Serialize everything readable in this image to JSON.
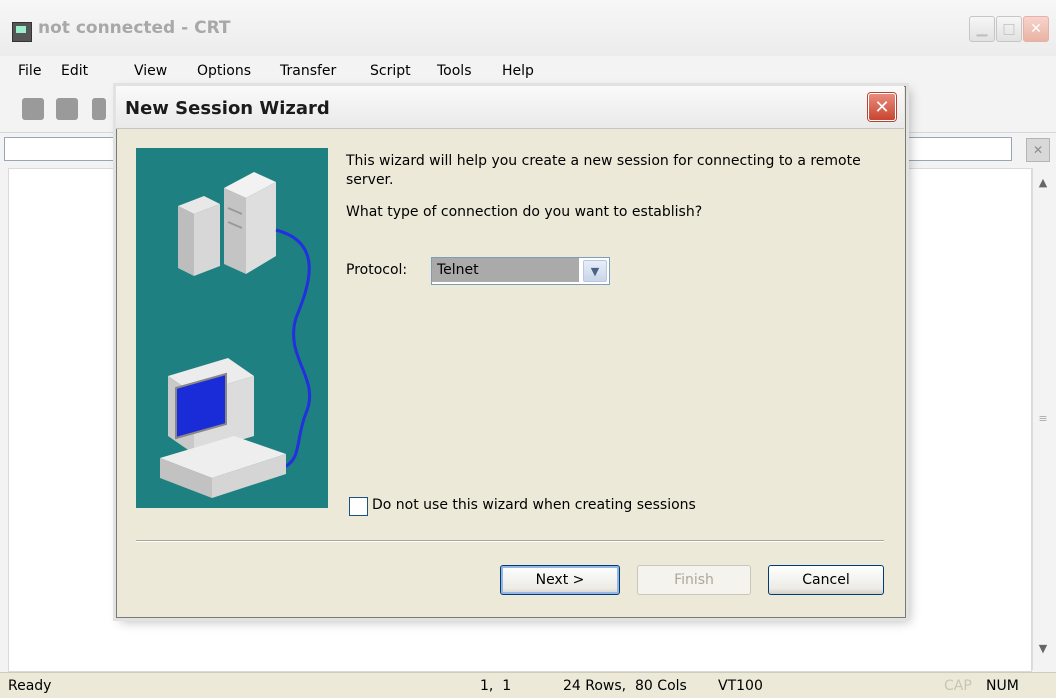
{
  "main_window": {
    "title": "not connected - CRT",
    "menu": [
      "File",
      "Edit",
      "View",
      "Options",
      "Transfer",
      "Script",
      "Tools",
      "Help"
    ]
  },
  "status_bar": {
    "ready": "Ready",
    "cursor": "1,  1",
    "size": "24 Rows,  80 Cols",
    "emulation": "VT100",
    "cap": "CAP",
    "num": "NUM"
  },
  "dialog": {
    "title": "New Session Wizard",
    "intro": "This wizard will help you create a new session for connecting to a remote server.",
    "question": "What type of connection do you want to establish?",
    "protocol_label": "Protocol:",
    "protocol_value": "Telnet",
    "checkbox_label": "Do not use this wizard when creating sessions",
    "checkbox_checked": false,
    "buttons": {
      "next": "Next >",
      "finish": "Finish",
      "cancel": "Cancel"
    }
  },
  "colors": {
    "illustration_bg": "#1e8080",
    "close_red": "#c8452f",
    "button_border": "#003c74"
  }
}
